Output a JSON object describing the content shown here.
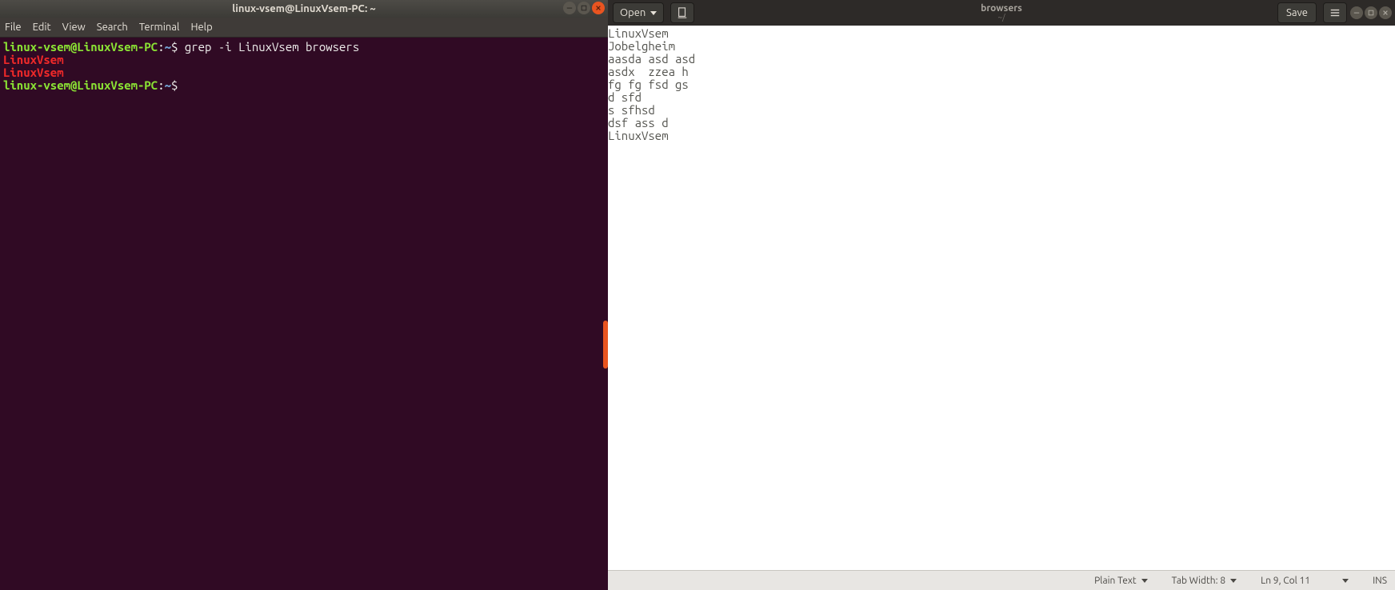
{
  "terminal": {
    "title": "linux-vsem@LinuxVsem-PC: ~",
    "menus": [
      "File",
      "Edit",
      "View",
      "Search",
      "Terminal",
      "Help"
    ],
    "prompt_user": "linux-vsem@LinuxVsem-PC",
    "prompt_sep": ":",
    "prompt_path": "~",
    "prompt_dollar": "$",
    "command": "grep -i LinuxVsem browsers",
    "output_matches": [
      "LinuxVsem",
      "LinuxVsem"
    ],
    "win_controls": [
      "minimize",
      "maximize",
      "close"
    ]
  },
  "gedit": {
    "open_label": "Open",
    "save_label": "Save",
    "title_main": "browsers",
    "title_sub": "~/",
    "file_lines": [
      "LinuxVsem",
      "Jobelgheim",
      "aasda asd asd",
      "asdx  zzea h",
      "fg fg fsd gs",
      "d sfd",
      "s sfhsd",
      "dsf ass d",
      "LinuxVsem"
    ],
    "statusbar": {
      "syntax": "Plain Text",
      "tabwidth_label": "Tab Width: 8",
      "cursor": "Ln 9, Col 11",
      "insert_mode": "INS"
    },
    "win_controls": [
      "minimize",
      "maximize",
      "close"
    ]
  }
}
